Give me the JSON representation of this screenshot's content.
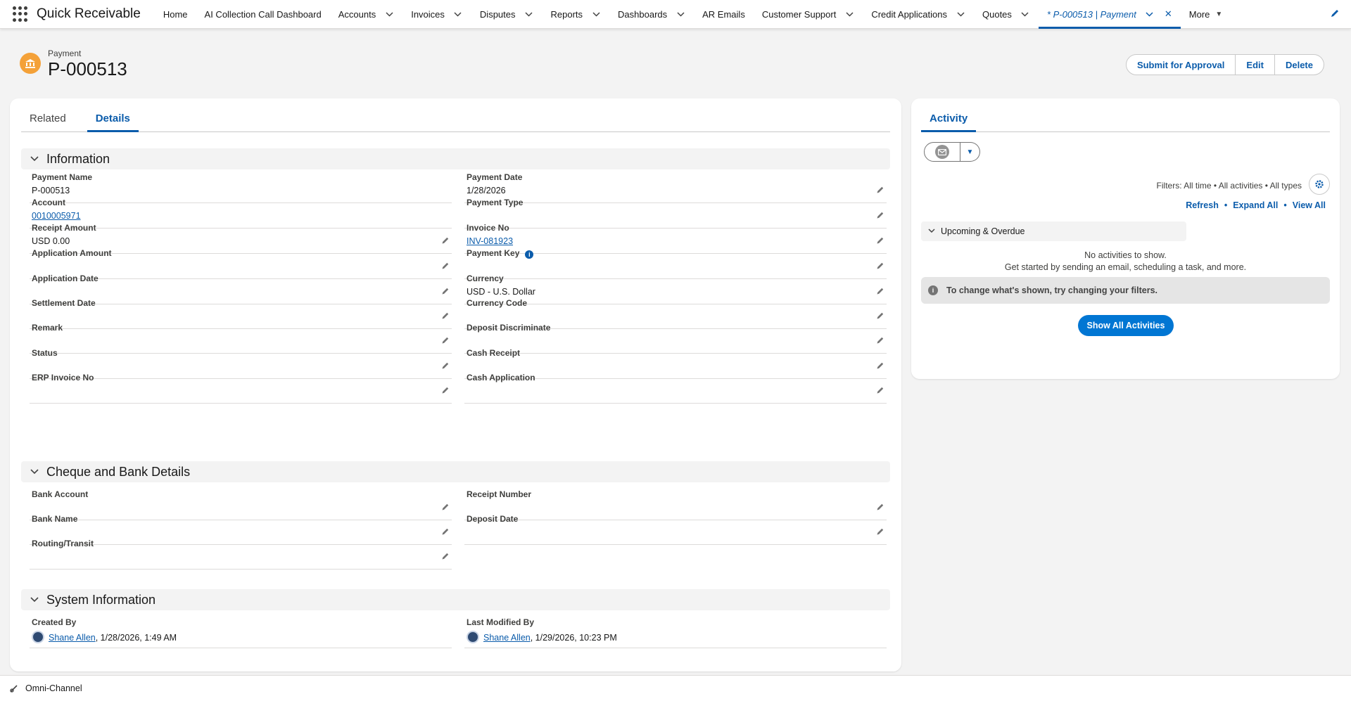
{
  "app": {
    "name": "Quick Receivable"
  },
  "nav": {
    "items": [
      {
        "label": "Home",
        "dropdown": false
      },
      {
        "label": "AI Collection Call Dashboard",
        "dropdown": false
      },
      {
        "label": "Accounts",
        "dropdown": true
      },
      {
        "label": "Invoices",
        "dropdown": true
      },
      {
        "label": "Disputes",
        "dropdown": true
      },
      {
        "label": "Reports",
        "dropdown": true
      },
      {
        "label": "Dashboards",
        "dropdown": true
      },
      {
        "label": "AR Emails",
        "dropdown": false
      },
      {
        "label": "Customer Support",
        "dropdown": true
      },
      {
        "label": "Credit Applications",
        "dropdown": true
      },
      {
        "label": "Quotes",
        "dropdown": true
      }
    ],
    "active_tab": "* P-000513 | Payment",
    "more": "More"
  },
  "record": {
    "type": "Payment",
    "name": "P-000513",
    "actions": {
      "submit": "Submit for Approval",
      "edit": "Edit",
      "delete": "Delete"
    }
  },
  "tabs": {
    "related": "Related",
    "details": "Details"
  },
  "sections": {
    "information": {
      "title": "Information",
      "left": [
        {
          "label": "Payment Name",
          "value": "P-000513",
          "link": false,
          "editable": false
        },
        {
          "label": "Account",
          "value": "0010005971",
          "link": true,
          "editable": false
        },
        {
          "label": "Receipt Amount",
          "value": "USD 0.00",
          "link": false,
          "editable": true
        },
        {
          "label": "Application Amount",
          "value": "",
          "link": false,
          "editable": true
        },
        {
          "label": "Application Date",
          "value": "",
          "link": false,
          "editable": true
        },
        {
          "label": "Settlement Date",
          "value": "",
          "link": false,
          "editable": true
        },
        {
          "label": "Remark",
          "value": "",
          "link": false,
          "editable": true
        },
        {
          "label": "Status",
          "value": "",
          "link": false,
          "editable": true
        },
        {
          "label": "ERP Invoice No",
          "value": "",
          "link": false,
          "editable": true
        }
      ],
      "right": [
        {
          "label": "Payment Date",
          "value": "1/28/2026",
          "link": false,
          "editable": true
        },
        {
          "label": "Payment Type",
          "value": "",
          "link": false,
          "editable": true
        },
        {
          "label": "Invoice No",
          "value": "INV-081923",
          "link": true,
          "editable": true
        },
        {
          "label": "Payment Key",
          "value": "",
          "link": false,
          "editable": true,
          "info": true
        },
        {
          "label": "Currency",
          "value": "USD - U.S. Dollar",
          "link": false,
          "editable": true
        },
        {
          "label": "Currency Code",
          "value": "",
          "link": false,
          "editable": true
        },
        {
          "label": "Deposit Discriminate",
          "value": "",
          "link": false,
          "editable": true
        },
        {
          "label": "Cash Receipt",
          "value": "",
          "link": false,
          "editable": true
        },
        {
          "label": "Cash Application",
          "value": "",
          "link": false,
          "editable": true
        }
      ]
    },
    "cheque": {
      "title": "Cheque and Bank Details",
      "left": [
        {
          "label": "Bank Account",
          "value": "",
          "editable": true
        },
        {
          "label": "Bank Name",
          "value": "",
          "editable": true
        },
        {
          "label": "Routing/Transit",
          "value": "",
          "editable": true
        }
      ],
      "right": [
        {
          "label": "Receipt Number",
          "value": "",
          "editable": true
        },
        {
          "label": "Deposit Date",
          "value": "",
          "editable": true
        }
      ]
    },
    "system": {
      "title": "System Information",
      "created_by": {
        "label": "Created By",
        "user": "Shane Allen",
        "date": ", 1/28/2026, 1:49 AM"
      },
      "modified_by": {
        "label": "Last Modified By",
        "user": "Shane Allen",
        "date": ", 1/29/2026, 10:23 PM"
      }
    }
  },
  "activity": {
    "tab": "Activity",
    "filters": "Filters: All time • All activities • All types",
    "links": {
      "refresh": "Refresh",
      "expand": "Expand All",
      "view_all": "View All"
    },
    "upcoming": "Upcoming & Overdue",
    "no_activities": "No activities to show.",
    "get_started": "Get started by sending an email, scheduling a task, and more.",
    "filter_note": "To change what's shown, try changing your filters.",
    "show_all": "Show All Activities"
  },
  "footer": {
    "omni": "Omni-Channel"
  },
  "colors": {
    "brand": "#0b5cab",
    "button_primary": "#0176d3",
    "payment_icon": "#f4a138"
  }
}
